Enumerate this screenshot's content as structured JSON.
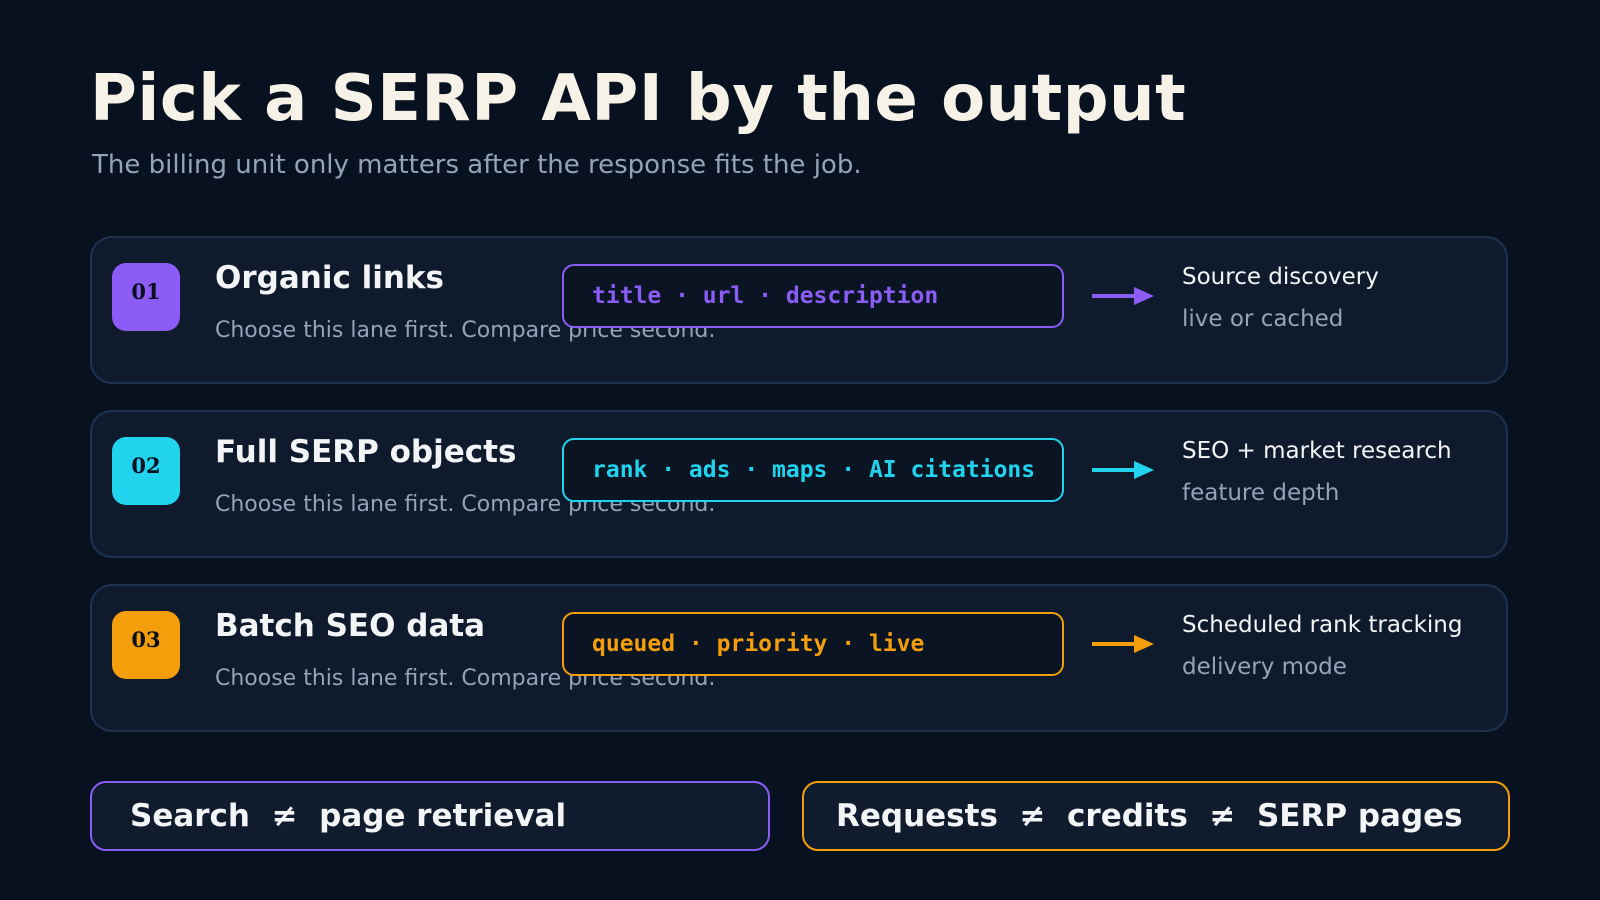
{
  "header": {
    "title": "Pick a SERP API by the output",
    "subtitle": "The billing unit only matters after the response fits the job."
  },
  "lanes": [
    {
      "number": "01",
      "title": "Organic links",
      "description": "Choose this lane first. Compare price second.",
      "fields": "title · url · description",
      "output_main": "Source discovery",
      "output_sub": "live or cached",
      "color": "#8b5cf6"
    },
    {
      "number": "02",
      "title": "Full SERP objects",
      "description": "Choose this lane first. Compare price second.",
      "fields": "rank · ads · maps · AI citations",
      "output_main": "SEO + market research",
      "output_sub": "feature depth",
      "color": "#22d3ee"
    },
    {
      "number": "03",
      "title": "Batch SEO data",
      "description": "Choose this lane first. Compare price second.",
      "fields": "queued · priority · live",
      "output_main": "Scheduled rank tracking",
      "output_sub": "delivery mode",
      "color": "#f59e0b"
    }
  ],
  "footer": {
    "left": "Search  ≠  page retrieval",
    "right": "Requests  ≠  credits  ≠  SERP pages",
    "left_color": "#8b5cf6",
    "right_color": "#f59e0b"
  },
  "icons": [
    "arrow-right-icon"
  ]
}
